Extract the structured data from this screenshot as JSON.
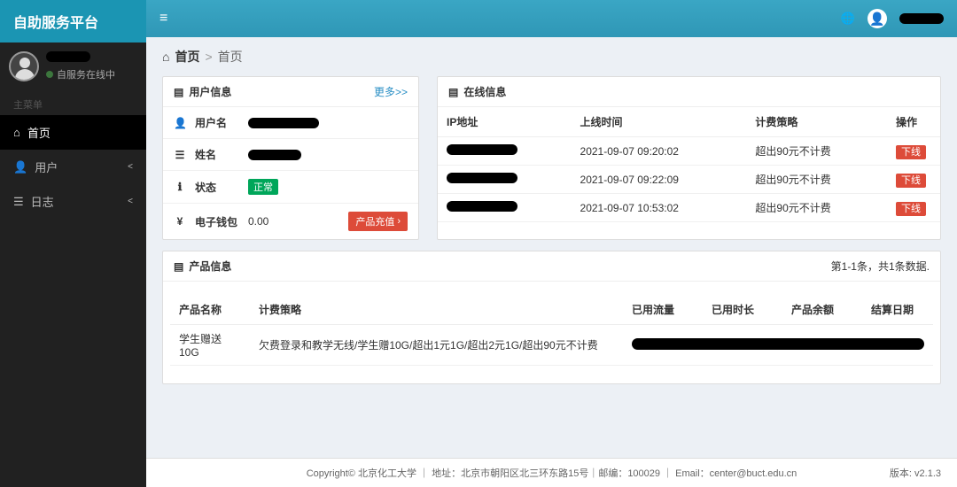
{
  "brand": "自助服务平台",
  "sidebar_user": {
    "status_text": "自服务在线中"
  },
  "menu": {
    "header": "主菜单",
    "home": "首页",
    "user": "用户",
    "log": "日志"
  },
  "breadcrumb": {
    "home": "首页",
    "sep": ">",
    "current": "首页"
  },
  "panels": {
    "user_info_title": "用户信息",
    "more": "更多>>",
    "online_info_title": "在线信息",
    "product_info_title": "产品信息"
  },
  "user_info": {
    "username_label": "用户名",
    "realname_label": "姓名",
    "status_label": "状态",
    "status_value": "正常",
    "wallet_label": "电子钱包",
    "wallet_value": "0.00",
    "recharge_btn": "产品充值"
  },
  "online_table": {
    "headers": {
      "ip": "IP地址",
      "time": "上线时间",
      "policy": "计费策略",
      "action": "操作"
    },
    "rows": [
      {
        "time": "2021-09-07 09:20:02",
        "policy": "超出90元不计费",
        "action": "下线"
      },
      {
        "time": "2021-09-07 09:22:09",
        "policy": "超出90元不计费",
        "action": "下线"
      },
      {
        "time": "2021-09-07 10:53:02",
        "policy": "超出90元不计费",
        "action": "下线"
      }
    ]
  },
  "product": {
    "count_text": "第1-1条，共1条数据.",
    "headers": {
      "name": "产品名称",
      "policy": "计费策略",
      "traffic": "已用流量",
      "duration": "已用时长",
      "balance": "产品余额",
      "settle": "结算日期"
    },
    "rows": [
      {
        "name": "学生赠送10G",
        "policy": "欠费登录和教学无线/学生赠10G/超出1元1G/超出2元1G/超出90元不计费"
      }
    ]
  },
  "footer": {
    "copyright": "Copyright© 北京化工大学 ｜ 地址：北京市朝阳区北三环东路15号｜邮编：100029 ｜ Email：center@buct.edu.cn",
    "version": "版本: v2.1.3"
  }
}
